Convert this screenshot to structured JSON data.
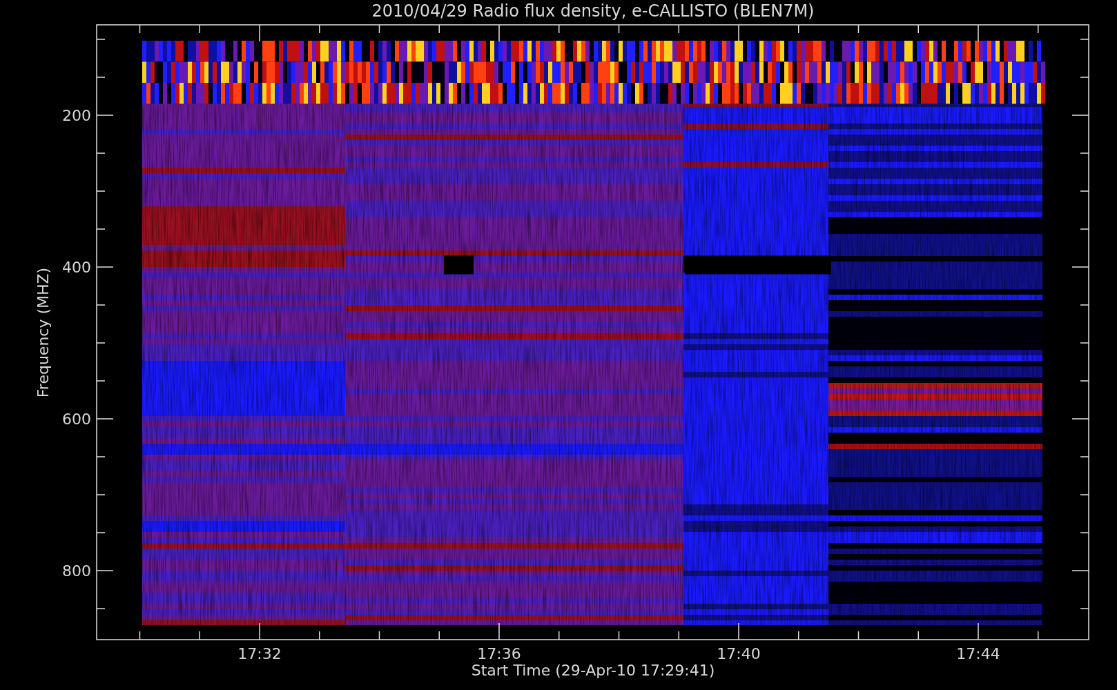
{
  "title": "2010/04/29  Radio flux density, e-CALLISTO (BLEN7M)",
  "y_axis": {
    "label": "Frequency (MHZ)",
    "ticks": [
      "200",
      "400",
      "600",
      "800"
    ]
  },
  "x_axis": {
    "label": "Start Time (29-Apr-10 17:29:41)",
    "ticks": [
      "17:32",
      "17:36",
      "17:40",
      "17:44"
    ]
  }
}
